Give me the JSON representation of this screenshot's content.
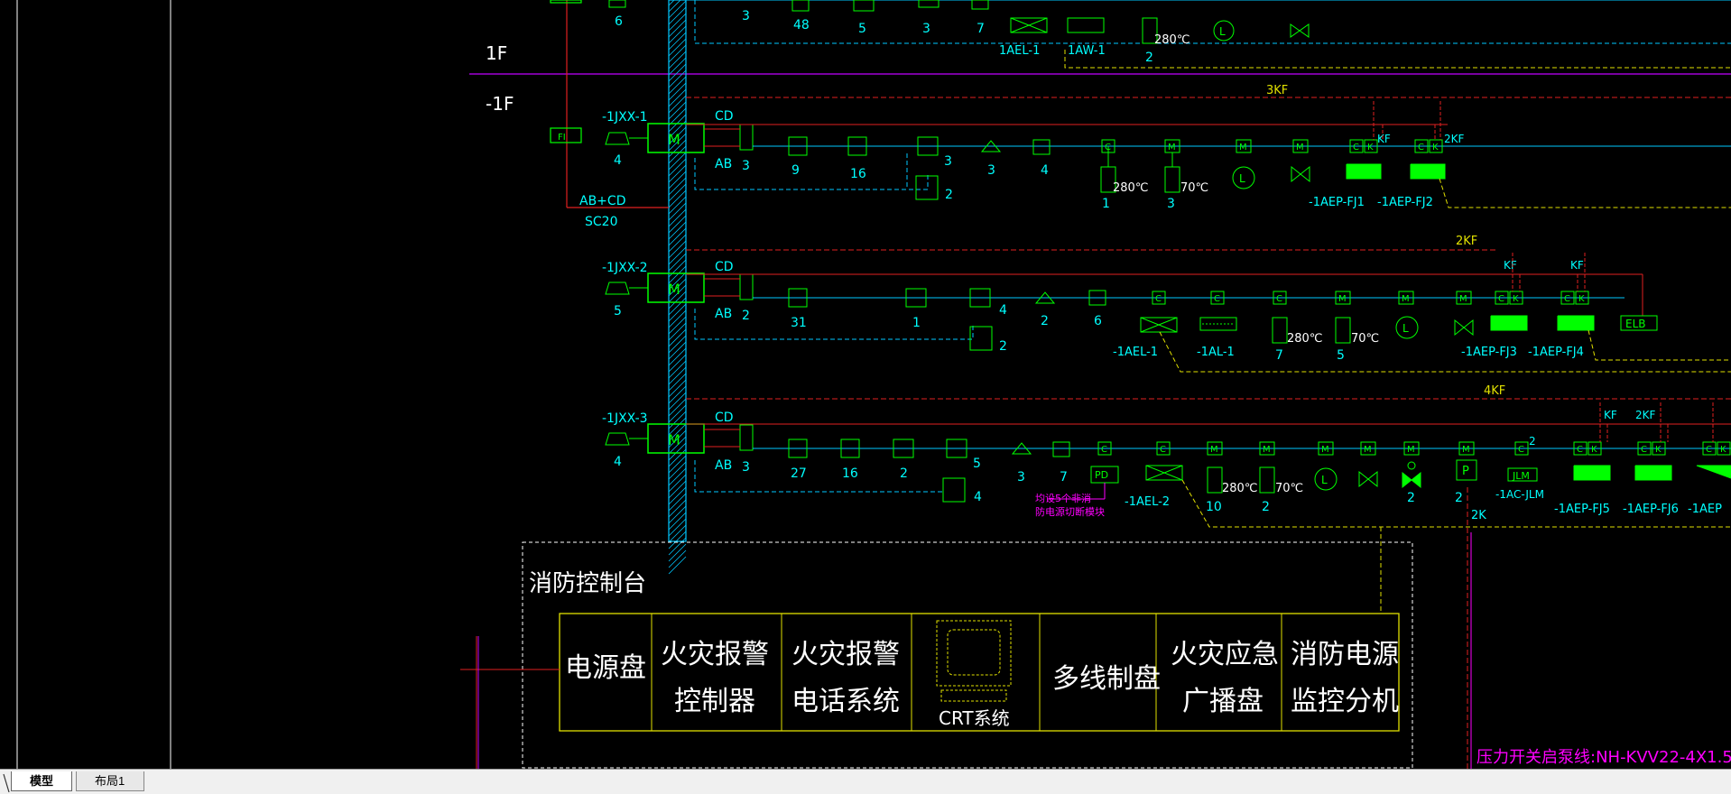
{
  "floors": {
    "upper": "1F",
    "lower": "-1F"
  },
  "meter_label": "FI",
  "feeder_label": "AB+CD",
  "feeder_conduit": "SC20",
  "top_row": {
    "counts": [
      "6",
      "3",
      "48",
      "5",
      "3",
      "7",
      "2"
    ],
    "devices": [
      "1AEL-1",
      "1AW-1"
    ],
    "temp": "280℃"
  },
  "modules": [
    {
      "name": "-1JXX-1",
      "cd": "CD",
      "ab": "AB",
      "count_a": "3",
      "horn_count": "4",
      "relay_label": "3KF",
      "counts": [
        "9",
        "16",
        "3",
        "3",
        "4"
      ],
      "phone_count": "2",
      "temps": [
        "280℃",
        "70℃"
      ],
      "temp_counts": [
        "1",
        "3"
      ],
      "kf_labels": [
        "KF",
        "2KF"
      ],
      "devices": [
        "-1AEP-FJ1",
        "-1AEP-FJ2"
      ]
    },
    {
      "name": "-1JXX-2",
      "cd": "CD",
      "ab": "AB",
      "count_a": "2",
      "horn_count": "5",
      "relay_label": "2KF",
      "counts": [
        "31",
        "1",
        "4",
        "2",
        "6"
      ],
      "phone_count": "2",
      "temps": [
        "280℃",
        "70℃"
      ],
      "temp_counts": [
        "7",
        "5"
      ],
      "kf_labels": [
        "KF",
        "KF"
      ],
      "devices": [
        "-1AEL-1",
        "-1AL-1",
        "-1AEP-FJ3",
        "-1AEP-FJ4"
      ],
      "elb": "ELB"
    },
    {
      "name": "-1JXX-3",
      "cd": "CD",
      "ab": "AB",
      "count_a": "3",
      "horn_count": "4",
      "relay_label": "4KF",
      "counts": [
        "27",
        "16",
        "2",
        "5",
        "3",
        "7"
      ],
      "phone_count": "4",
      "pd": "PD",
      "pd_note": [
        "均设5个非消",
        "防电源切断模块"
      ],
      "temps": [
        "280℃",
        "70℃"
      ],
      "temp_counts": [
        "10",
        "2"
      ],
      "kf_labels": [
        "KF",
        "2KF"
      ],
      "p_label": "P",
      "p_count": "2",
      "pump_count": "2",
      "jlm": "JLM",
      "acjlm": "-1AC-JLM",
      "small_2": "2",
      "k2": "2K",
      "devices": [
        "-1AEL-2",
        "-1AEP-FJ5",
        "-1AEP-FJ6",
        "-1AEP"
      ]
    }
  ],
  "console": {
    "title": "消防控制台",
    "cells": [
      {
        "l1": "电源盘",
        "l2": ""
      },
      {
        "l1": "火灾报警",
        "l2": "控制器"
      },
      {
        "l1": "火灾报警",
        "l2": "电话系统"
      },
      {
        "l1": "CRT系统",
        "l2": ""
      },
      {
        "l1": "多线制盘",
        "l2": ""
      },
      {
        "l1": "火灾应急",
        "l2": "广播盘"
      },
      {
        "l1": "消防电源",
        "l2": "监控分机"
      }
    ]
  },
  "pressure_note": "压力开关启泵线:NH-KVV22-4X1.5",
  "tabs": {
    "model": "模型",
    "layout1": "布局1"
  }
}
